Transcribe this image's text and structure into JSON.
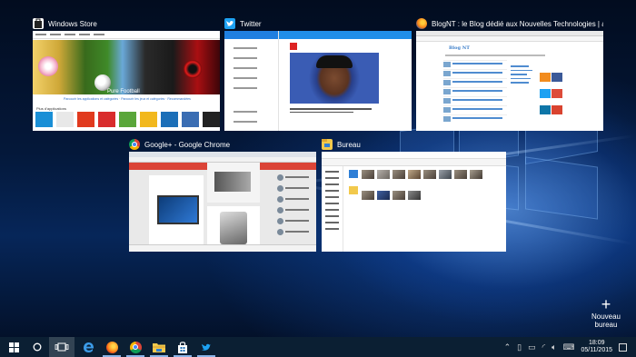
{
  "task_view": {
    "windows": [
      {
        "title": "Windows Store",
        "icon": "windows-store-icon"
      },
      {
        "title": "Twitter",
        "icon": "twitter-bird-icon"
      },
      {
        "title": "BlogNT : le Blog dédié aux Nouvelles Technologies | actu...",
        "icon": "firefox-icon"
      },
      {
        "title": "Google+ - Google Chrome",
        "icon": "chrome-icon"
      },
      {
        "title": "Bureau",
        "icon": "file-explorer-icon"
      }
    ],
    "new_desktop_label": "Nouveau bureau",
    "store_preview": {
      "hero_text": "Pure Football",
      "links": "Parcourir les applications et catégories · Parcourir les jeux et catégories · Recommandées",
      "section": "Plus d'applications"
    },
    "blog_preview": {
      "logo": "Blog NT"
    }
  },
  "taskbar": {
    "pinned": [
      {
        "name": "start-button",
        "icon": "windows-logo-icon"
      },
      {
        "name": "cortana-button",
        "icon": "cortana-circle-icon"
      },
      {
        "name": "task-view-button",
        "icon": "task-view-icon"
      },
      {
        "name": "edge-button",
        "icon": "edge-icon"
      },
      {
        "name": "firefox-button",
        "icon": "firefox-icon"
      },
      {
        "name": "chrome-button",
        "icon": "chrome-icon"
      },
      {
        "name": "explorer-button",
        "icon": "folder-icon"
      },
      {
        "name": "store-button",
        "icon": "store-bag-icon"
      },
      {
        "name": "twitter-button",
        "icon": "twitter-bird-icon"
      }
    ],
    "clock": {
      "time": "18:09",
      "date": "05/11/2015"
    }
  },
  "colors": {
    "taskbar": "#0b1f33",
    "accent": "#1f7fe0",
    "twitter": "#1da1f2",
    "google_plus": "#db4437"
  }
}
